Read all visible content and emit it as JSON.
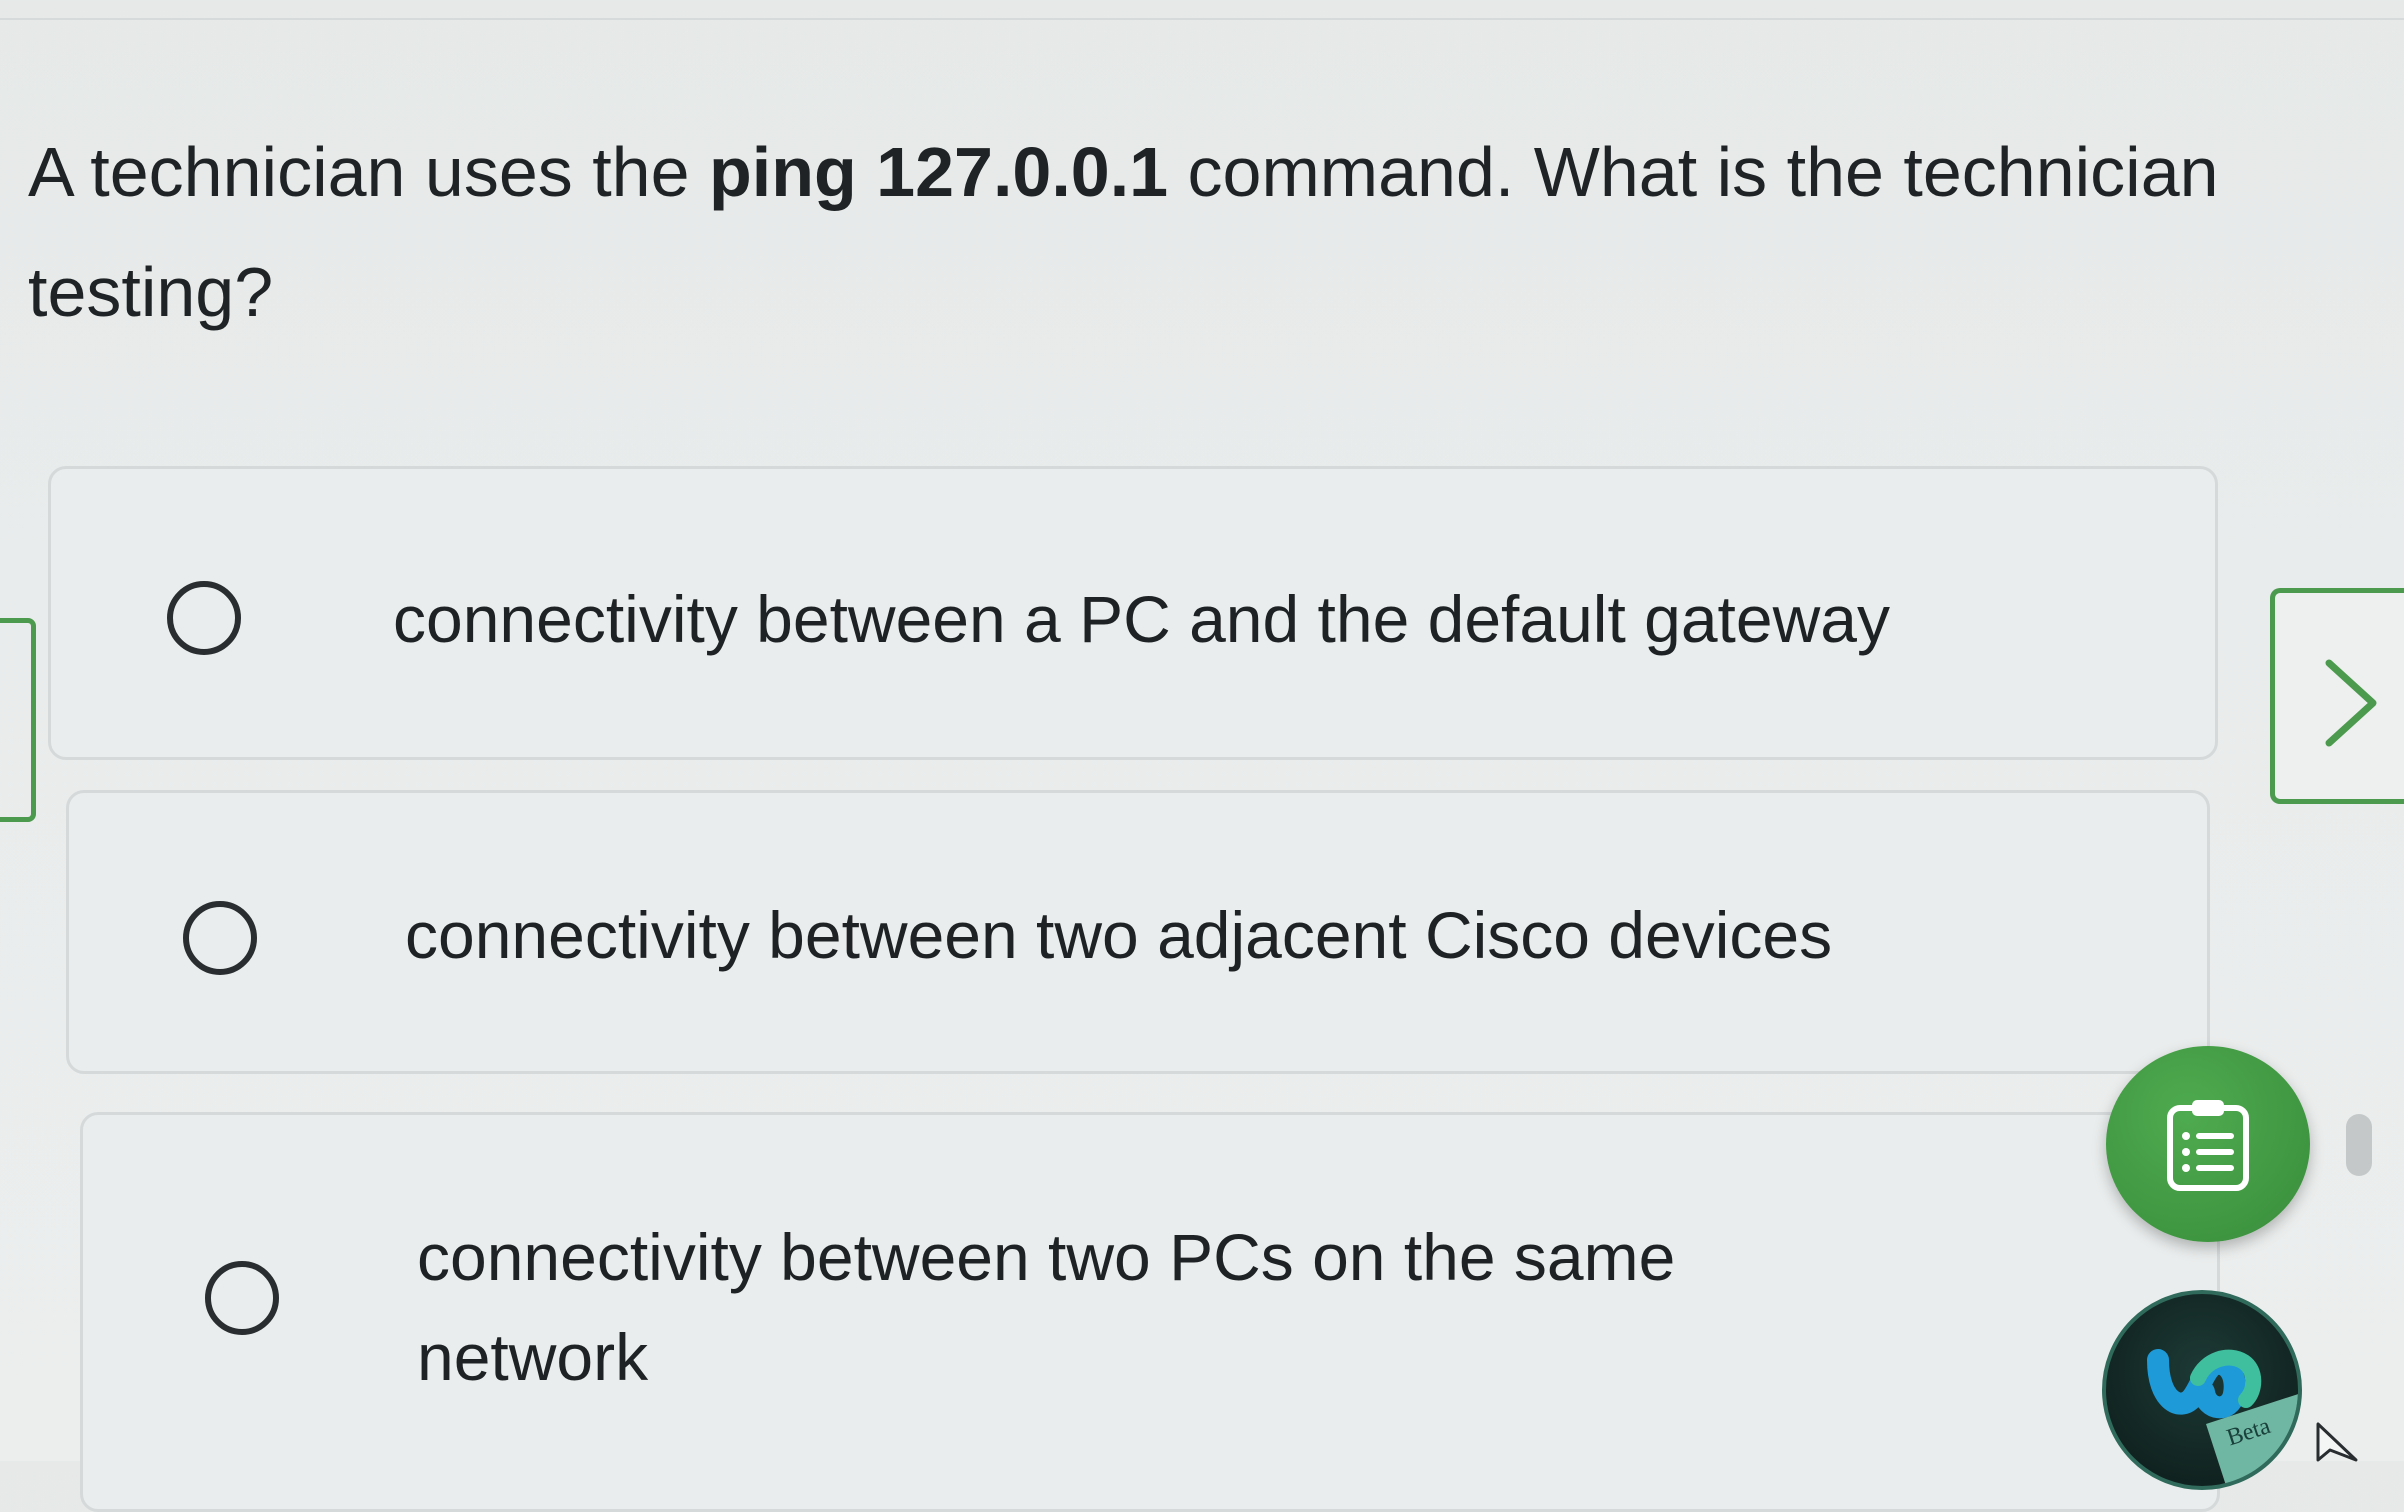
{
  "question": {
    "prefix": "A technician uses the ",
    "command": "ping 127.0.0.1",
    "suffix": " command. What is the technician testing?"
  },
  "options": [
    {
      "label": "connectivity between a PC and the default gateway",
      "selected": false
    },
    {
      "label": "connectivity between two adjacent Cisco devices",
      "selected": false
    },
    {
      "label": "connectivity between two PCs on the same network",
      "selected": false
    }
  ],
  "navigation": {
    "next_icon": "chevron-right-icon",
    "prev_tab_icon": "side-tab"
  },
  "floating_buttons": {
    "notes_icon": "clipboard-list-icon",
    "webex_icon": "webex-logo-icon",
    "webex_badge": "Beta"
  },
  "colors": {
    "accent_green": "#4b9a4d",
    "fab_green": "#3f9641",
    "text": "#1f2224",
    "option_border": "#d5d9da"
  }
}
